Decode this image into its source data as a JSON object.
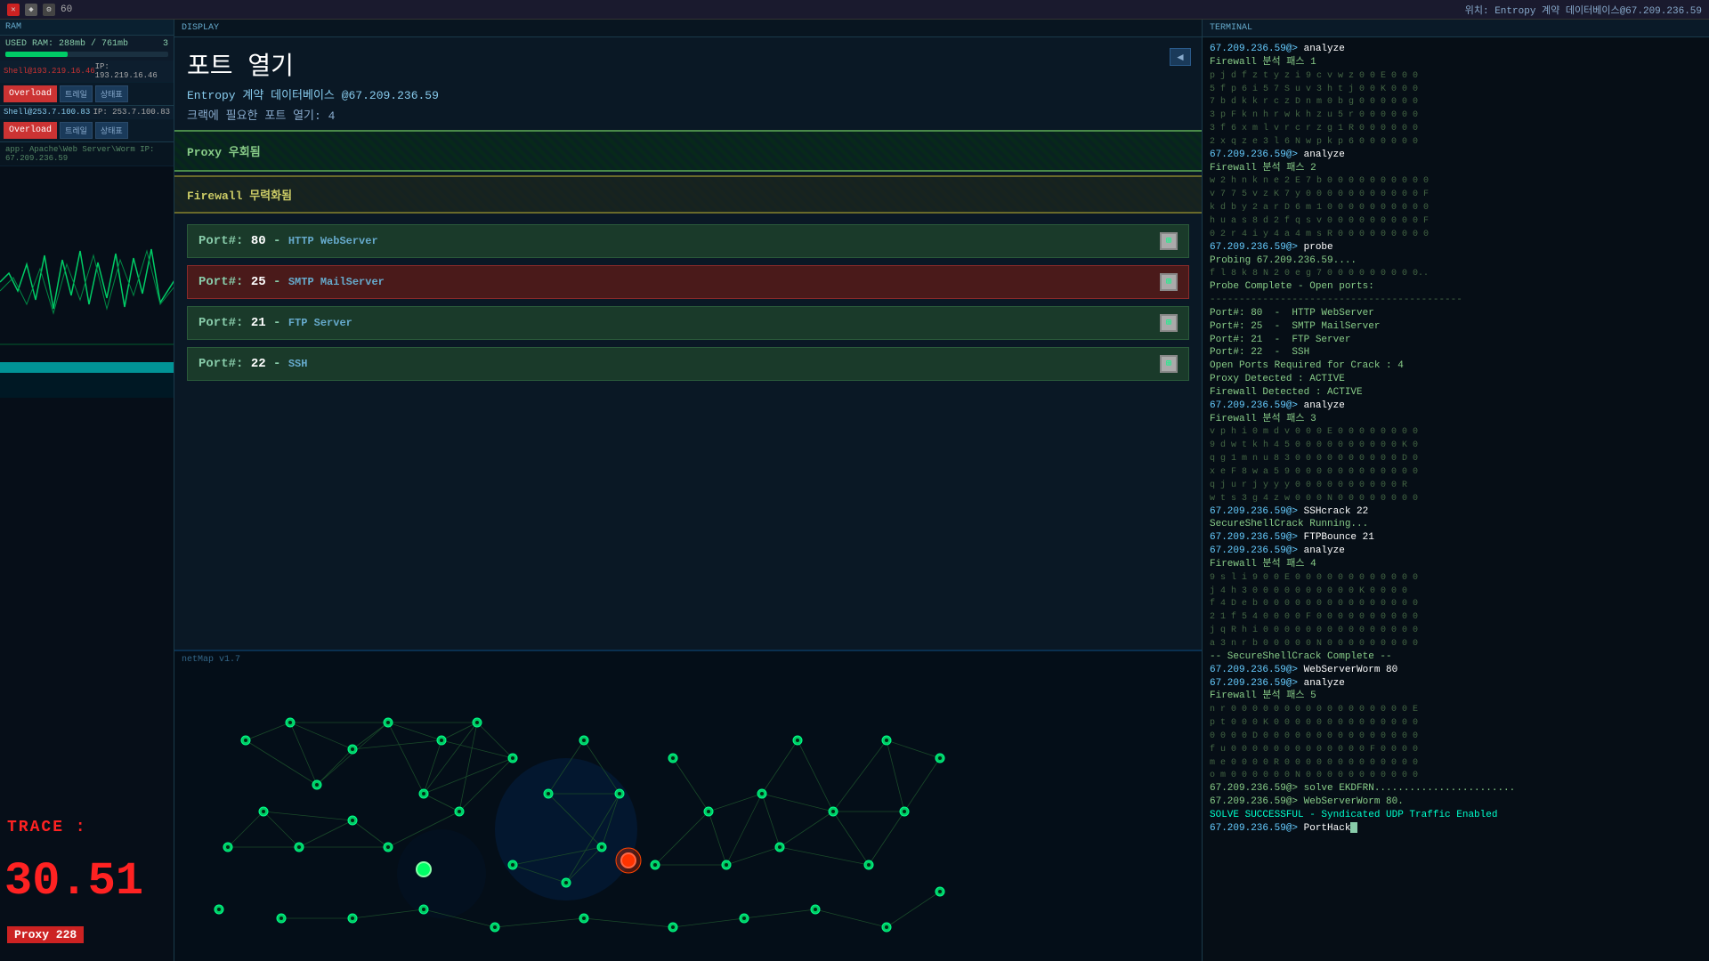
{
  "topbar": {
    "icons": [
      "x",
      "◆",
      "⚙"
    ],
    "number": "60",
    "status_text": "위치: Entropy 계약 데이터베이스@67.209.236.59"
  },
  "left_panel": {
    "section_label": "RAM",
    "ram_used": "288mb",
    "ram_total": "761mb",
    "ram_number": "3",
    "connection1": {
      "label": "Shell@193.219.16.46",
      "ip": "IP: 193.219.16.46"
    },
    "btn_overload": "Overload",
    "btn_trace": "트레일",
    "btn_status": "상태표",
    "connection2": {
      "label": "Shell@253.7.100.83",
      "ip": "IP: 253.7.100.83"
    },
    "app_label": "app: Apache\\Web Server\\Worm IP: 67.209.236.59",
    "proxy_label": "Proxy 228",
    "trace_label": "TRACE :",
    "trace_value": "30.51"
  },
  "display": {
    "header": "DISPLAY",
    "title": "포트 열기",
    "target": "Entropy 계약 데이터베이스 @67.209.236.59",
    "crack_info": "크랙에 필요한 포트 열기: 4",
    "proxy_section": "Proxy 우회됨",
    "firewall_section": "Firewall 무력화됨",
    "ports": [
      {
        "number": "80",
        "service": "HTTP WebServer",
        "highlighted": false
      },
      {
        "number": "25",
        "service": "SMTP MailServer",
        "highlighted": true
      },
      {
        "number": "21",
        "service": "FTP Server",
        "highlighted": false
      },
      {
        "number": "22",
        "service": "SSH",
        "highlighted": false
      }
    ],
    "netmap_label": "netMap v1.7"
  },
  "terminal": {
    "header": "TERMINAL",
    "lines": [
      {
        "type": "prompt",
        "text": "67.209.236.59@> analyze"
      },
      {
        "type": "output",
        "text": "Firewall 분석 패스 1"
      },
      {
        "type": "data",
        "text": "p j d f z t y z i 9 c v w z 0 0 E 0 0 0"
      },
      {
        "type": "data",
        "text": "5 f p 6 i 5 7 S u v 3 h t j 0 0 K 0 0 0"
      },
      {
        "type": "data",
        "text": "7 b d k k r c z D n m 0 b g 0 0 0 0 0 0"
      },
      {
        "type": "data",
        "text": "3 p F k n h r w k h z u 5 r 0 0 0 0 0 0"
      },
      {
        "type": "data",
        "text": "3 f 6 x m l v r c r z g 1 R 0 0 0 0 0 0"
      },
      {
        "type": "data",
        "text": "2 x q z e 3 l 6 N w p k p 6 0 0 0 0 0 0"
      },
      {
        "type": "separator",
        "text": ""
      },
      {
        "type": "prompt",
        "text": "67.209.236.59@> analyze"
      },
      {
        "type": "output",
        "text": "Firewall 분석 패스 2"
      },
      {
        "type": "separator",
        "text": ""
      },
      {
        "type": "data",
        "text": "w 2 h n k n e 2 E 7 b 0 0 0 0 0 0 0 0 0 0"
      },
      {
        "type": "data",
        "text": "v 7 7 5 v z K 7 y 0 0 0 0 0 0 0 0 0 0 0 F"
      },
      {
        "type": "data",
        "text": "k d b y 2 a r D 6 m 1 0 0 0 0 0 0 0 0 0 0"
      },
      {
        "type": "data",
        "text": "h u a s 8 d 2 f q s v 0 0 0 0 0 0 0 0 0 F"
      },
      {
        "type": "data",
        "text": "0 2 r 4 i y 4 a 4 m s R 0 0 0 0 0 0 0 0 0"
      },
      {
        "type": "prompt",
        "text": "67.209.236.59@> probe"
      },
      {
        "type": "output",
        "text": "Probing 67.209.236.59...."
      },
      {
        "type": "data",
        "text": "f l 8 k 8 N 2 0 e g 7 0 0 0 0 0 0 0 0 0.."
      },
      {
        "type": "separator",
        "text": ""
      },
      {
        "type": "output",
        "text": "Probe Complete - Open ports:"
      },
      {
        "type": "separator2",
        "text": "-------------------------------------------"
      },
      {
        "type": "output",
        "text": "Port#: 80  -  HTTP WebServer"
      },
      {
        "type": "output",
        "text": "Port#: 25  -  SMTP MailServer"
      },
      {
        "type": "output",
        "text": "Port#: 21  -  FTP Server"
      },
      {
        "type": "output",
        "text": "Port#: 22  -  SSH"
      },
      {
        "type": "separator2",
        "text": ""
      },
      {
        "type": "output",
        "text": "Open Ports Required for Crack : 4"
      },
      {
        "type": "output",
        "text": "Proxy Detected : ACTIVE"
      },
      {
        "type": "output",
        "text": "Firewall Detected : ACTIVE"
      },
      {
        "type": "prompt",
        "text": "67.209.236.59@> analyze"
      },
      {
        "type": "output",
        "text": "Firewall 분석 패스 3"
      },
      {
        "type": "separator",
        "text": ""
      },
      {
        "type": "data",
        "text": "v p h i 0 m d v 0 0 0 E 0 0 0 0 0 0 0 0"
      },
      {
        "type": "data",
        "text": "9 d w t k h 4 5 0 0 0 0 0 0 0 0 0 0 K 0"
      },
      {
        "type": "data",
        "text": "q g 1 m n u 8 3 0 0 0 0 0 0 0 0 0 0 D 0"
      },
      {
        "type": "data",
        "text": "x e F 8 w a 5 9 0 0 0 0 0 0 0 0 0 0 0 0"
      },
      {
        "type": "data",
        "text": "q j u r j y y y 0 0 0 0 0 0 0 0 0 0 R"
      },
      {
        "type": "data",
        "text": "w t s 3 g 4 z w 0 0 0 N 0 0 0 0 0 0 0 0"
      },
      {
        "type": "separator",
        "text": ""
      },
      {
        "type": "prompt",
        "text": "67.209.236.59@> SSHcrack 22"
      },
      {
        "type": "output",
        "text": "SecureShellCrack Running..."
      },
      {
        "type": "prompt",
        "text": "67.209.236.59@> FTPBounce 21"
      },
      {
        "type": "prompt",
        "text": "67.209.236.59@> analyze"
      },
      {
        "type": "output",
        "text": "Firewall 분석 패스 4"
      },
      {
        "type": "separator",
        "text": ""
      },
      {
        "type": "data",
        "text": "9 s l i 9 0 0 E 0 0 0 0 0 0 0 0 0 0 0 0"
      },
      {
        "type": "data",
        "text": "j 4 h 3 0 0 0 0 0 0 0 0 0 0 K 0 0 0 0"
      },
      {
        "type": "data",
        "text": "f 4 D e b 0 0 0 0 0 0 0 0 0 0 0 0 0 0 0"
      },
      {
        "type": "data",
        "text": "2 1 f 5 4 0 0 0 0 F 0 0 0 0 0 0 0 0 0 0"
      },
      {
        "type": "data",
        "text": "j q R h i 0 0 0 0 0 0 0 0 0 0 0 0 0 0 0"
      },
      {
        "type": "data",
        "text": "a 3 n r b 0 0 0 0 0 N 0 0 0 0 0 0 0 0 0"
      },
      {
        "type": "separator",
        "text": ""
      },
      {
        "type": "output",
        "text": "-- SecureShellCrack Complete --"
      },
      {
        "type": "prompt",
        "text": "67.209.236.59@> WebServerWorm 80"
      },
      {
        "type": "prompt",
        "text": "67.209.236.59@> analyze"
      },
      {
        "type": "output",
        "text": "Firewall 분석 패스 5"
      },
      {
        "type": "separator",
        "text": ""
      },
      {
        "type": "data",
        "text": "n r 0 0 0 0 0 0 0 0 0 0 0 0 0 0 0 0 0 E"
      },
      {
        "type": "data",
        "text": "p t 0 0 0 K 0 0 0 0 0 0 0 0 0 0 0 0 0 0"
      },
      {
        "type": "data",
        "text": "0 0 0 0 D 0 0 0 0 0 0 0 0 0 0 0 0 0 0 0"
      },
      {
        "type": "data",
        "text": "f u 0 0 0 0 0 0 0 0 0 0 0 0 0 F 0 0 0 0"
      },
      {
        "type": "data",
        "text": "m e 0 0 0 0 R 0 0 0 0 0 0 0 0 0 0 0 0 0"
      },
      {
        "type": "data",
        "text": "o m 0 0 0 0 0 0 N 0 0 0 0 0 0 0 0 0 0 0"
      },
      {
        "type": "separator",
        "text": ""
      },
      {
        "type": "output",
        "text": "67.209.236.59@> solve EKDFRN........................"
      },
      {
        "type": "output",
        "text": "67.209.236.59@> WebServerWorm 80."
      },
      {
        "type": "success",
        "text": "SOLVE SUCCESSFUL - Syndicated UDP Traffic Enabled"
      },
      {
        "type": "separator",
        "text": ""
      },
      {
        "type": "prompt_active",
        "text": "67.209.236.59@> PortHack"
      }
    ]
  }
}
